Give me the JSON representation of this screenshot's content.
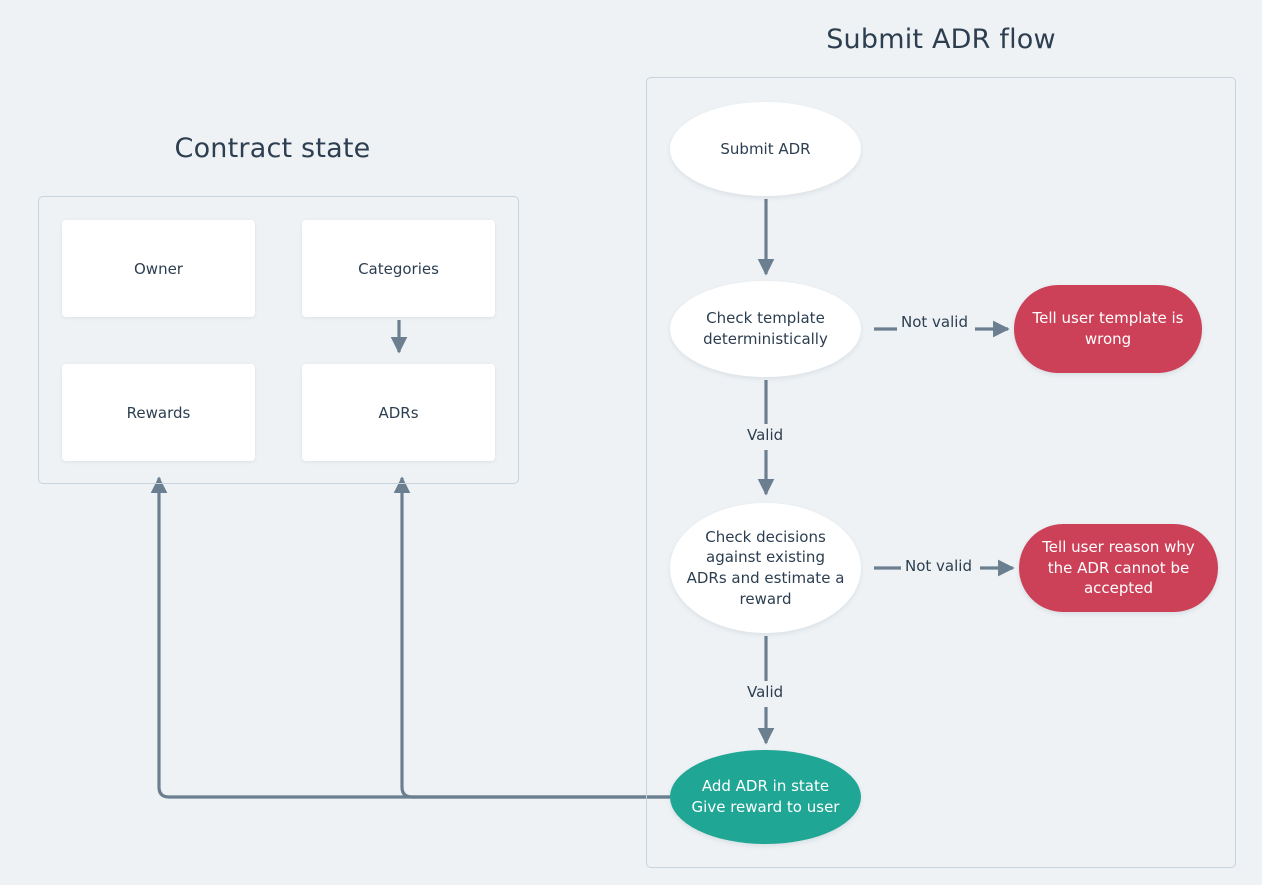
{
  "page": {
    "background_color": "#eef2f5",
    "text_color": "#2c3e50"
  },
  "sections": {
    "contract_state": {
      "title": "Contract state",
      "boxes": [
        {
          "label": "Owner"
        },
        {
          "label": "Categories"
        },
        {
          "label": "Rewards"
        },
        {
          "label": "ADRs"
        }
      ]
    },
    "submit_flow": {
      "title": "Submit ADR flow",
      "nodes": [
        {
          "id": "submit-adr",
          "label": "Submit ADR",
          "style": "white",
          "color": "#ffffff"
        },
        {
          "id": "check-template",
          "label": "Check template deterministically",
          "style": "white",
          "color": "#ffffff"
        },
        {
          "id": "check-decisions",
          "label": "Check decisions against existing ADRs and estimate a reward",
          "style": "white",
          "color": "#ffffff"
        },
        {
          "id": "tell-template-wrong",
          "label": "Tell user template is wrong",
          "style": "danger",
          "color": "#cc4158"
        },
        {
          "id": "tell-reason",
          "label": "Tell user reason why the ADR cannot be accepted",
          "style": "danger",
          "color": "#cc4158"
        },
        {
          "id": "add-adr",
          "label": "Add ADR in state Give reward to user",
          "style": "success",
          "color": "#1fa694"
        }
      ]
    }
  },
  "edge_labels": {
    "not_valid_template": "Not valid",
    "not_valid_decisions": "Not valid",
    "valid_template": "Valid",
    "valid_decisions": "Valid"
  },
  "node_text": {
    "submit_adr": "Submit ADR",
    "check_template_line1": "Check template",
    "check_template_line2": "deterministically",
    "check_decisions_line1": "Check decisions",
    "check_decisions_line2": "against existing",
    "check_decisions_line3": "ADRs and estimate a",
    "check_decisions_line4": "reward",
    "tell_template_line1": "Tell user template is",
    "tell_template_line2": "wrong",
    "tell_reason_line1": "Tell user reason why",
    "tell_reason_line2": "the ADR cannot be",
    "tell_reason_line3": "accepted",
    "add_adr_line1": "Add ADR in state",
    "add_adr_line2": "Give reward to user"
  },
  "colors": {
    "edge": "#6b7f91",
    "panel_border": "#c7d3de",
    "danger": "#cc4158",
    "success": "#1fa694",
    "node_white": "#ffffff",
    "title": "#2c3e50"
  }
}
